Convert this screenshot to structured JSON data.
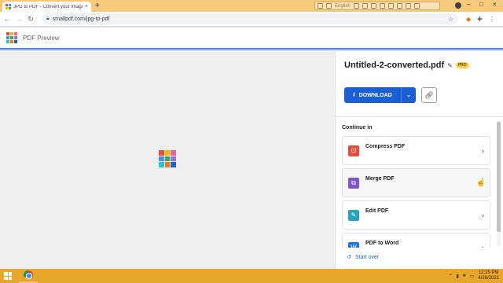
{
  "browser": {
    "tab_title": "JPG to PDF - Convert your Images",
    "tab_close": "×",
    "new_tab": "+",
    "url": "smallpdf.com/jpg-to-pdf",
    "ext_lang": "English",
    "window_minimize": "–",
    "window_maximize": "□",
    "window_close": "×"
  },
  "header": {
    "title": "PDF Preview",
    "logo_colors": [
      "#e84b3c",
      "#f4b400",
      "#f06292",
      "#4c8cf5",
      "#34a853",
      "#9c6ade",
      "#26c6da",
      "#f57c00",
      "#1a5fd6"
    ]
  },
  "side_panel": {
    "file_name": "Untitled-2-converted.pdf",
    "pro_badge": "PRO",
    "download_label": "DOWNLOAD",
    "continue_label": "Continue in",
    "tools": [
      {
        "name": "Compress PDF",
        "color": "#e84b3c",
        "icon": "compress-icon"
      },
      {
        "name": "Merge PDF",
        "color": "#7e57c2",
        "icon": "merge-icon"
      },
      {
        "name": "Edit PDF",
        "color": "#26a5b8",
        "icon": "edit-icon"
      },
      {
        "name": "PDF to Word",
        "color": "#1a73e8",
        "icon": "word-icon"
      }
    ],
    "start_over": "Start over"
  },
  "taskbar": {
    "time": "12:29 PM",
    "date": "4/26/2021"
  },
  "colors": {
    "accent": "#1a5fd6",
    "tabstrip": "#f7c97b",
    "taskbar": "#e8a62b"
  }
}
